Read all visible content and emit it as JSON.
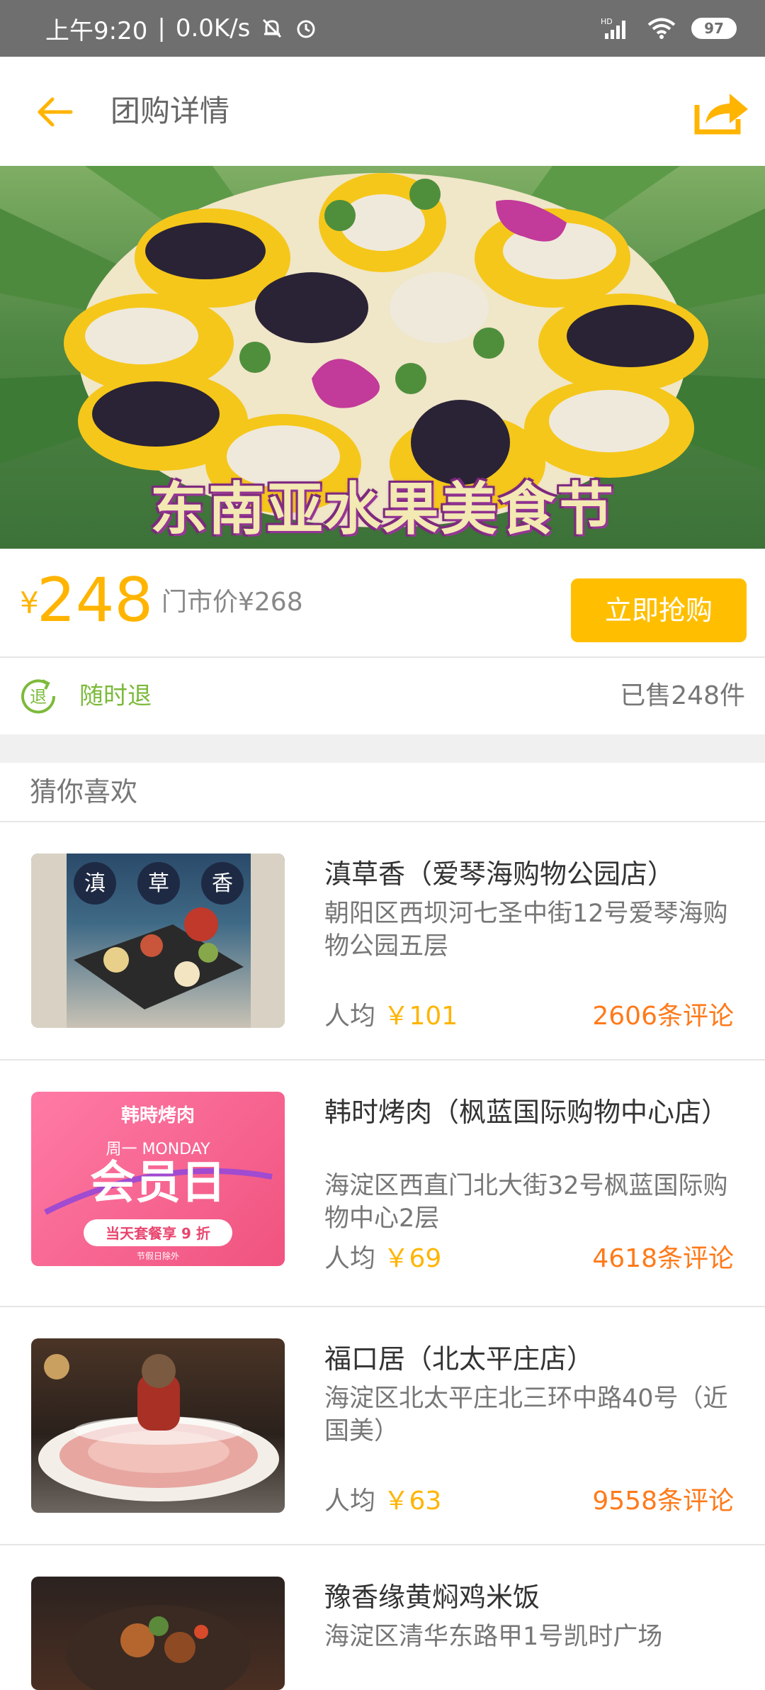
{
  "status_bar": {
    "time": "上午9:20",
    "network": "0.0K/s",
    "signal": "HD",
    "battery": "97"
  },
  "header": {
    "title": "团购详情"
  },
  "hero": {
    "banner_text": "东南亚水果美食节"
  },
  "deal": {
    "currency": "¥",
    "price": "248",
    "market_price": "门市价¥268",
    "buy_label": "立即抢购",
    "refund_label": "随时退",
    "sold": "已售248件"
  },
  "section": {
    "title": "猜你喜欢"
  },
  "items": [
    {
      "name": "滇草香（爱琴海购物公园店）",
      "address": "朝阳区西坝河七圣中街12号爱琴海购物公园五层",
      "avg_label": "人均",
      "avg": "￥101",
      "reviews": "2606条评论",
      "thumb_text": [
        "滇",
        "草",
        "香"
      ]
    },
    {
      "name": "韩时烤肉（枫蓝国际购物中心店）",
      "address": "海淀区西直门北大街32号枫蓝国际购物中心2层",
      "avg_label": "人均",
      "avg": "￥69",
      "reviews": "4618条评论",
      "thumb_text": [
        "韩時烤肉",
        "周一 MONDAY",
        "会员日",
        "当天套餐享 9 折",
        "节假日除外"
      ]
    },
    {
      "name": "福口居（北太平庄店）",
      "address": "海淀区北太平庄北三环中路40号（近国美）",
      "avg_label": "人均",
      "avg": "￥63",
      "reviews": "9558条评论"
    },
    {
      "name": "豫香缘黄焖鸡米饭",
      "address": "海淀区清华东路甲1号凯时广场"
    }
  ]
}
